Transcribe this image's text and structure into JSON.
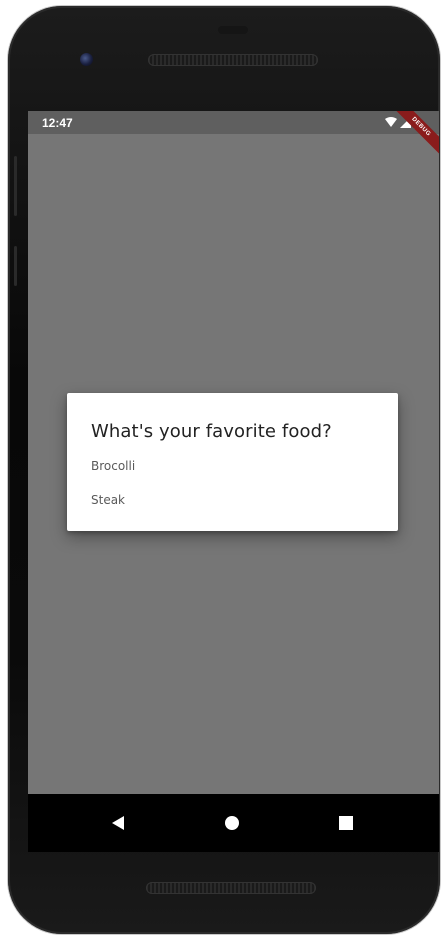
{
  "status_bar": {
    "time": "12:47",
    "debug_label": "DEBUG"
  },
  "dialog": {
    "title": "What's your favorite food?",
    "options": [
      {
        "label": "Brocolli"
      },
      {
        "label": "Steak"
      }
    ]
  },
  "icons": {
    "wifi": "wifi-icon",
    "signal": "cellular-signal-icon",
    "battery": "battery-icon",
    "back": "back-triangle-icon",
    "home": "home-circle-icon",
    "recents": "recents-square-icon"
  },
  "colors": {
    "scrim": "#767676",
    "status_bar": "#5f5f5f",
    "debug_banner": "#8a1c1c",
    "dialog_bg": "#ffffff",
    "nav_bar": "#000000"
  }
}
